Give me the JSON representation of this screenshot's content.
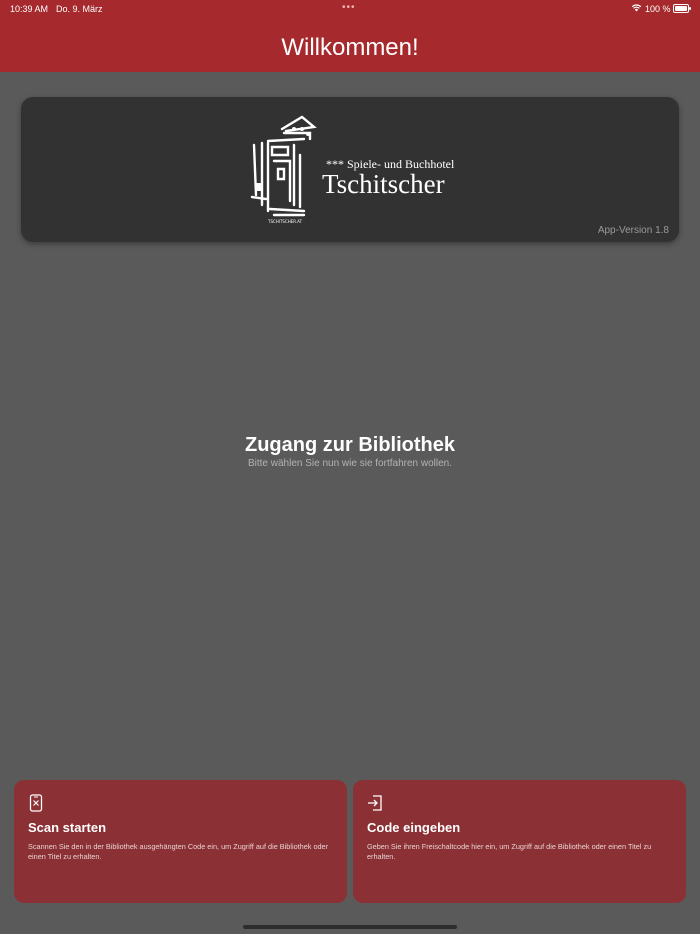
{
  "status_bar": {
    "time": "10:39 AM",
    "date": "Do. 9. März",
    "battery_pct": "100 %"
  },
  "header": {
    "title": "Willkommen!"
  },
  "logo_card": {
    "logo_line1": "*** Spiele- und Buchhotel",
    "logo_line2": "Tschitscher",
    "version": "App-Version 1.8"
  },
  "main": {
    "title": "Zugang zur Bibliothek",
    "subtitle": "Bitte wählen Sie nun wie sie fortfahren wollen."
  },
  "actions": [
    {
      "icon": "qr-scan-icon",
      "title": "Scan starten",
      "description": "Scannen Sie den in der Bibliothek ausgehängten Code ein, um Zugriff auf die Bibliothek oder einen Titel zu erhalten."
    },
    {
      "icon": "sign-in-icon",
      "title": "Code eingeben",
      "description": "Geben Sie ihren Freischaltcode hier ein, um Zugriff auf die Bibliothek oder einen Titel zu erhalten."
    }
  ],
  "colors": {
    "brand": "#a5292d",
    "card": "#8b3034",
    "background": "#5a5a5a",
    "logo_card": "#323232"
  }
}
